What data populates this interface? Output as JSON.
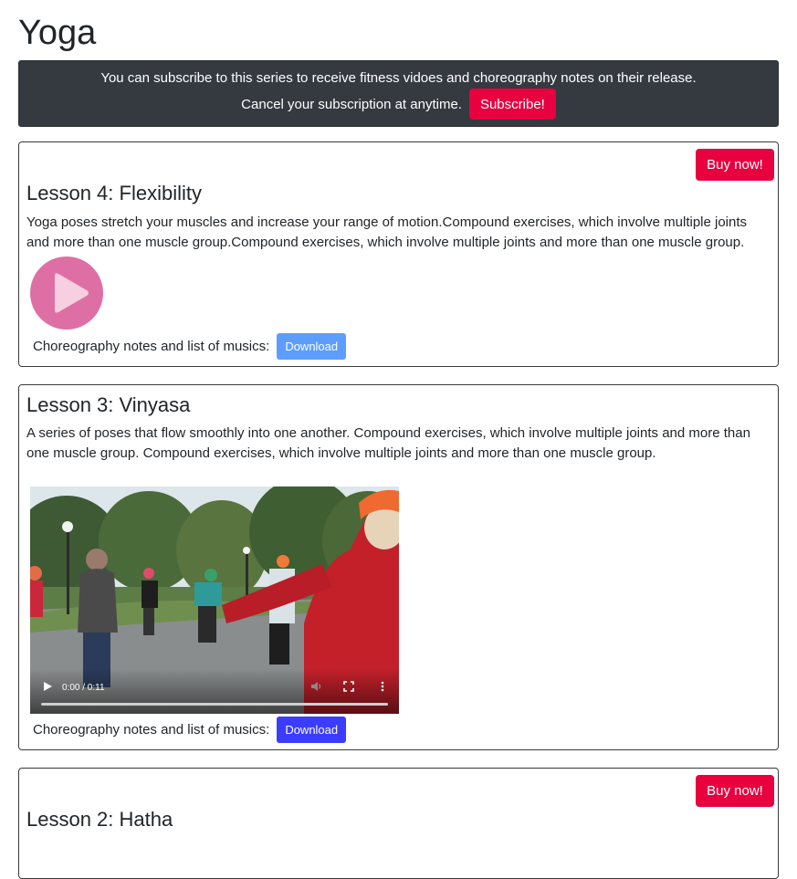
{
  "page": {
    "title": "Yoga"
  },
  "banner": {
    "line1": "You can subscribe to this series to receive fitness vidoes and choreography notes on their release.",
    "line2": "Cancel your subscription at anytime.",
    "subscribe_label": "Subscribe!"
  },
  "colors": {
    "accent": "#e8003f",
    "banner_bg": "#343a40",
    "download_light": "#5c9dff",
    "download_strong": "#3c3cff",
    "play_icon": "#de6fa4"
  },
  "lessons": [
    {
      "buy_label": "Buy now!",
      "title": "Lesson 4: Flexibility",
      "description": "Yoga poses stretch your muscles and increase your range of motion.Compound exercises, which involve multiple joints and more than one muscle group.Compound exercises, which involve multiple joints and more than one muscle group.",
      "media": "play-icon",
      "notes_label": "Choreography notes and list of musics:",
      "download_label": "Download"
    },
    {
      "title": "Lesson 3: Vinyasa",
      "description": "A series of poses that flow smoothly into one another. Compound exercises, which involve multiple joints and more than one muscle group. Compound exercises, which involve multiple joints and more than one muscle group.",
      "media": "video",
      "video_time": "0:00 / 0:11",
      "notes_label": "Choreography notes and list of musics:",
      "download_label": "Download"
    },
    {
      "buy_label": "Buy now!",
      "title": "Lesson 2: Hatha"
    }
  ]
}
